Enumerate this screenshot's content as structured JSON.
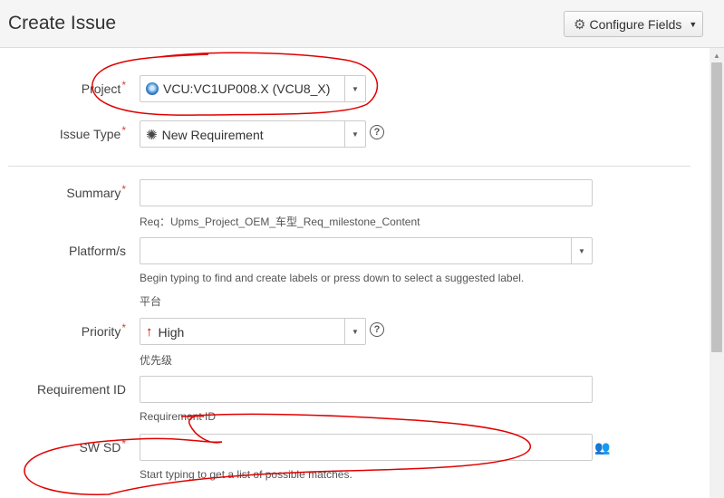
{
  "header": {
    "title": "Create Issue",
    "configure_label": "Configure Fields",
    "icons": {
      "configure": "gear-icon",
      "caret": "chevron-down-icon"
    }
  },
  "fields": {
    "project": {
      "label": "Project",
      "value": "VCU:VC1UP008.X (VCU8_X)",
      "icon": "project-avatar-icon"
    },
    "issue_type": {
      "label": "Issue Type",
      "value": "New Requirement",
      "icon": "lightbulb-icon"
    },
    "summary": {
      "label": "Summary",
      "value": "",
      "hint": "Req：Upms_Project_OEM_车型_Req_milestone_Content"
    },
    "platform": {
      "label": "Platform/s",
      "value": "",
      "hint": "Begin typing to find and create labels or press down to select a suggested label.",
      "hint2": "平台"
    },
    "priority": {
      "label": "Priority",
      "value": "High",
      "icon": "arrow-up-icon",
      "hint": "优先级"
    },
    "requirement_id": {
      "label": "Requirement ID",
      "value": "",
      "hint": "Requirement ID"
    },
    "sw_sd": {
      "label": "SW SD",
      "value": "",
      "hint": "Start typing to get a list of possible matches.",
      "icon": "user-picker-icon"
    }
  },
  "required_marker": "*",
  "colors": {
    "required": "#d04437",
    "priority_high": "#cc0000",
    "annotation": "#e00000"
  }
}
